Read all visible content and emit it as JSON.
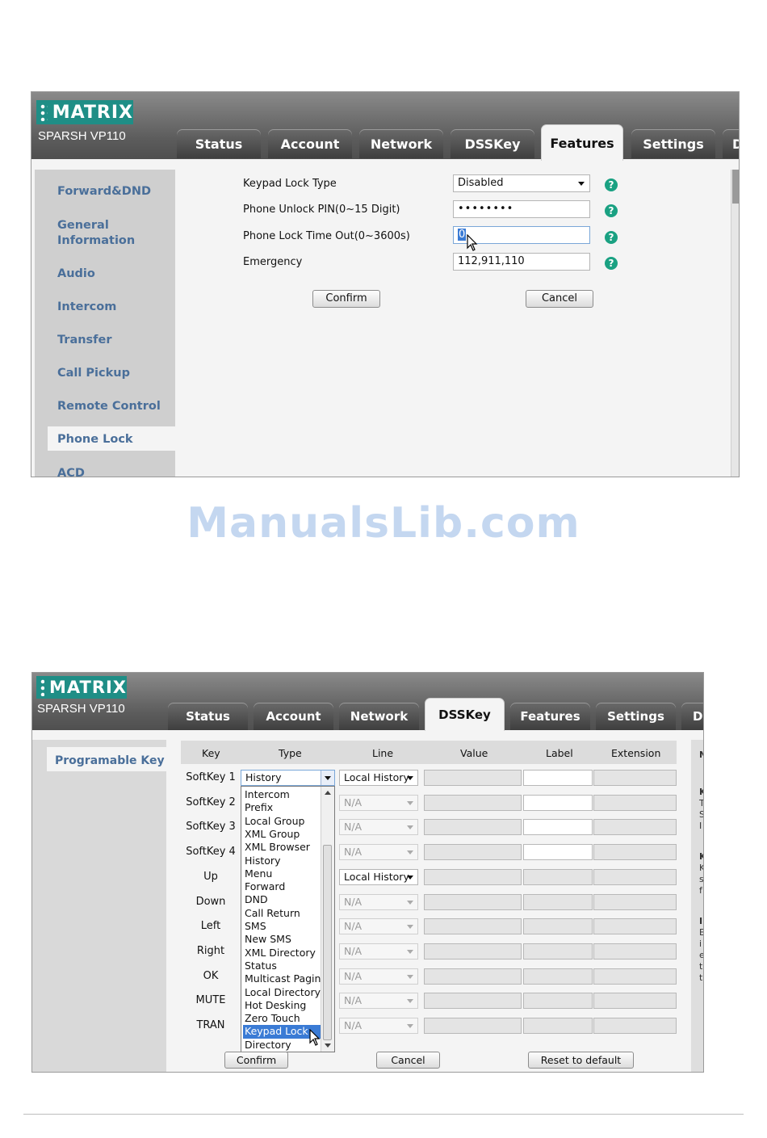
{
  "screen1": {
    "brand": "MATRIX",
    "model": "SPARSH VP110",
    "tabs": [
      "Status",
      "Account",
      "Network",
      "DSSKey",
      "Features",
      "Settings",
      "D"
    ],
    "active_tab": "Features",
    "sidebar": [
      "Forward&DND",
      "General Information",
      "Audio",
      "Intercom",
      "Transfer",
      "Call Pickup",
      "Remote Control",
      "Phone Lock",
      "ACD"
    ],
    "selected_sidebar": "Phone Lock",
    "form": {
      "keypad_lock_type_label": "Keypad Lock Type",
      "keypad_lock_type_value": "Disabled",
      "unlock_pin_label": "Phone Unlock PIN(0~15 Digit)",
      "unlock_pin_value": "••••••••",
      "lock_timeout_label": "Phone Lock Time Out(0~3600s)",
      "lock_timeout_value": "0",
      "emergency_label": "Emergency",
      "emergency_value": "112,911,110",
      "help_glyph": "?"
    },
    "buttons": {
      "confirm": "Confirm",
      "cancel": "Cancel"
    }
  },
  "watermark": "ManualsLib.com",
  "screen2": {
    "brand": "MATRIX",
    "model": "SPARSH VP110",
    "tabs": [
      "Status",
      "Account",
      "Network",
      "DSSKey",
      "Features",
      "Settings",
      "Di"
    ],
    "active_tab": "DSSKey",
    "sidebar_item": "Programable Key",
    "columns": [
      "Key",
      "Type",
      "Line",
      "Value",
      "Label",
      "Extension"
    ],
    "rows": [
      {
        "key": "SoftKey 1",
        "line": "Local History",
        "line_enabled": true
      },
      {
        "key": "SoftKey 2",
        "line": "N/A",
        "line_enabled": false
      },
      {
        "key": "SoftKey 3",
        "line": "N/A",
        "line_enabled": false
      },
      {
        "key": "SoftKey 4",
        "line": "N/A",
        "line_enabled": false
      },
      {
        "key": "Up",
        "line": "Local History",
        "line_enabled": true
      },
      {
        "key": "Down",
        "line": "N/A",
        "line_enabled": false
      },
      {
        "key": "Left",
        "line": "N/A",
        "line_enabled": false
      },
      {
        "key": "Right",
        "line": "N/A",
        "line_enabled": false
      },
      {
        "key": "OK",
        "line": "N/A",
        "line_enabled": false
      },
      {
        "key": "MUTE",
        "line": "N/A",
        "line_enabled": false
      },
      {
        "key": "TRAN",
        "line": "N/A",
        "line_enabled": false
      }
    ],
    "type_selected": "History",
    "dropdown_options": [
      "Intercom",
      "Prefix",
      "Local Group",
      "XML Group",
      "XML Browser",
      "History",
      "Menu",
      "Forward",
      "DND",
      "Call Return",
      "SMS",
      "New SMS",
      "XML Directory",
      "Status",
      "Multicast Paging",
      "Local Directory",
      "Hot Desking",
      "Zero Touch",
      "Keypad Lock",
      "Directory"
    ],
    "dropdown_highlighted": "Keypad Lock",
    "buttons": {
      "confirm": "Confirm",
      "cancel": "Cancel",
      "reset": "Reset to default"
    },
    "right_panel_letters": [
      "N",
      "K",
      "T",
      "S",
      "I",
      "K",
      "K",
      "s",
      "f",
      "I",
      "E",
      "i",
      "e",
      "t",
      "t"
    ]
  },
  "colors": {
    "accent_teal": "#1f8e86",
    "nav_blue": "#4a6f9a",
    "highlight": "#3a7bd5",
    "help_green": "#1aa182"
  }
}
